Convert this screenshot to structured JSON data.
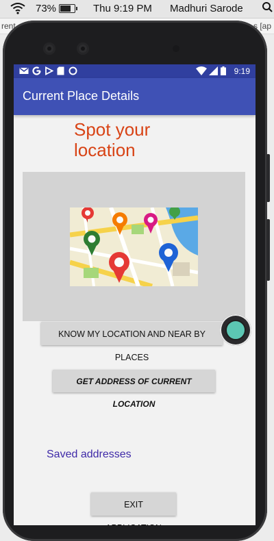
{
  "mac_menubar": {
    "battery_percent": "73%",
    "battery_level": 0.73,
    "clock": "Thu 9:19 PM",
    "user": "Madhuri Sarode"
  },
  "desktop_strip": {
    "left_text": "rent",
    "right_text": "s [ap"
  },
  "android_status": {
    "time": "9:19"
  },
  "app": {
    "title": "Current Place Details",
    "heading": "Spot your location",
    "near_places_button": "KNOW MY LOCATION AND NEAR BY PLACES",
    "address_button": "GET ADDRESS OF CURRENT LOCATION",
    "saved_addresses_link": "Saved addresses",
    "exit_button": "EXIT APPLICATION"
  },
  "colors": {
    "status_bar": "#303f9f",
    "app_bar": "#3f51b5",
    "heading": "#d84315",
    "link": "#3f2aa8",
    "fab": "#5cc7b3"
  },
  "icons": {
    "wifi": "wifi-icon",
    "battery": "battery-icon",
    "search": "search-icon",
    "gmail": "gmail-icon",
    "google": "google-icon",
    "play": "play-icon",
    "sd_card": "sd-card-icon",
    "sync": "circle-icon",
    "signal": "signal-icon"
  }
}
